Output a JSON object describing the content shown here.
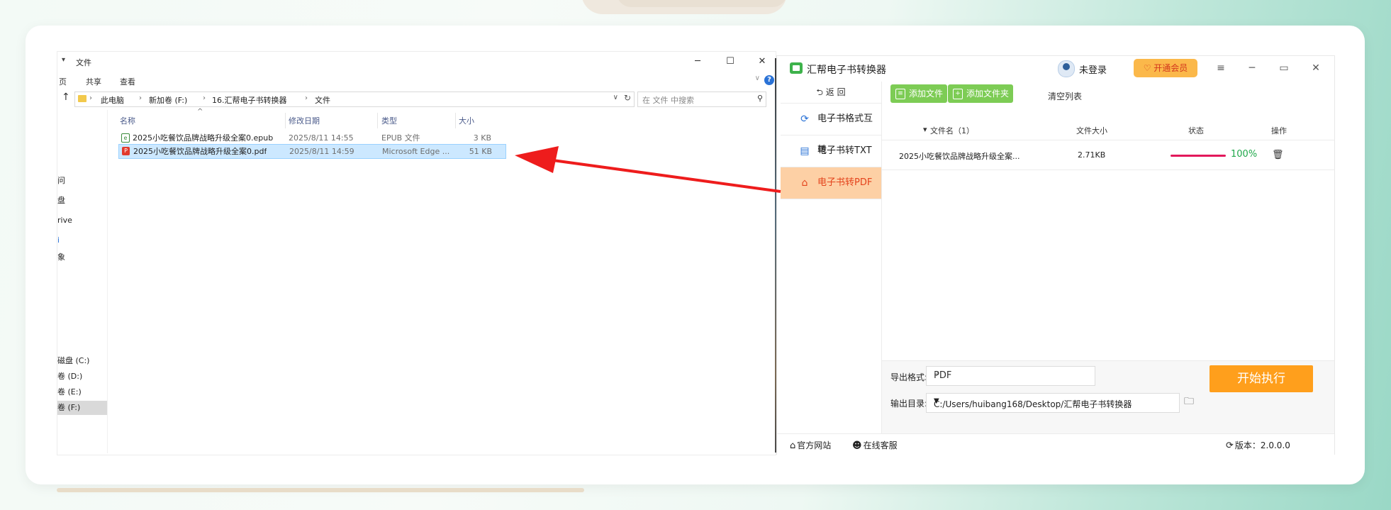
{
  "explorer": {
    "window_title": "文件",
    "ribbon_tabs": [
      "页",
      "共享",
      "查看"
    ],
    "breadcrumb": [
      "此电脑",
      "新加卷 (F:)",
      "16.汇帮电子书转换器",
      "文件"
    ],
    "search_placeholder": "在 文件 中搜索",
    "nav_items": [
      "问",
      "盘",
      "rive",
      "i",
      "象",
      "磁盘 (C:)",
      "卷 (D:)",
      "卷 (E:)",
      "卷 (F:)"
    ],
    "columns": [
      "名称",
      "修改日期",
      "类型",
      "大小"
    ],
    "files": [
      {
        "name": "2025小吃餐饮品牌战略升级全案0.epub",
        "date": "2025/8/11 14:55",
        "type": "EPUB 文件",
        "size": "3 KB",
        "icon": "epub-file-icon",
        "selected": false
      },
      {
        "name": "2025小吃餐饮品牌战略升级全案0.pdf",
        "date": "2025/8/11 14:59",
        "type": "Microsoft Edge ...",
        "size": "51 KB",
        "icon": "pdf-file-icon",
        "selected": true
      }
    ]
  },
  "app": {
    "title": "汇帮电子书转换器",
    "user_status": "未登录",
    "vip_label": "开通会员",
    "back_label": "返  回",
    "sidebar": [
      {
        "label": "电子书格式互转",
        "icon": "refresh-icon",
        "active": false
      },
      {
        "label": "电子书转TXT",
        "icon": "document-icon",
        "active": false
      },
      {
        "label": "电子书转PDF",
        "icon": "pdf-icon",
        "active": true
      }
    ],
    "toolbar": {
      "add_file": "添加文件",
      "add_folder": "添加文件夹",
      "clear_list": "清空列表"
    },
    "list_headers": {
      "name": "文件名（1）",
      "size": "文件大小",
      "status": "状态",
      "action": "操作"
    },
    "rows": [
      {
        "name": "2025小吃餐饮品牌战略升级全案...",
        "size": "2.71KB",
        "progress": 1.0,
        "progress_text": "100%"
      }
    ],
    "export_format_label": "导出格式:",
    "export_format_value": "PDF",
    "output_dir_label": "输出目录:",
    "output_dir_value": "C:/Users/huibang168/Desktop/汇帮电子书转换器",
    "start_label": "开始执行",
    "status": {
      "website": "官方网站",
      "support": "在线客服",
      "version": "版本：2.0.0.0"
    }
  },
  "colors": {
    "accent_green": "#7dcc55",
    "start_orange": "#ff9f1c",
    "active_side_bg": "#fdd0a5",
    "progress": "#e2185b",
    "arrow": "#ee1c1c"
  }
}
